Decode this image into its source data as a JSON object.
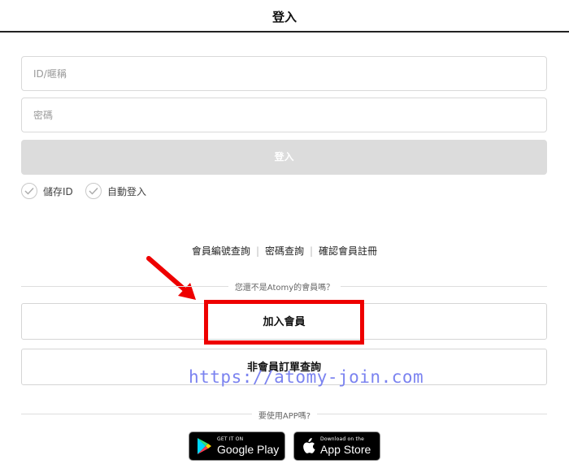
{
  "header": {
    "title": "登入"
  },
  "form": {
    "id_placeholder": "ID/暱稱",
    "password_placeholder": "密碼",
    "login_button": "登入",
    "save_id_label": "儲存ID",
    "auto_login_label": "自動登入"
  },
  "links": {
    "member_number_lookup": "會員編號查詢",
    "password_lookup": "密碼查詢",
    "confirm_registration": "確認會員註冊"
  },
  "signup": {
    "prompt": "您還不是Atomy的會員嗎？",
    "join_button": "加入會員",
    "nonmember_order_button": "非會員訂單查詢"
  },
  "watermark": "https://atomy-join.com",
  "app": {
    "prompt": "要使用APP嗎?",
    "google_small": "GET IT ON",
    "google_big": "Google Play",
    "apple_small": "Download on the",
    "apple_big": "App Store"
  },
  "colors": {
    "highlight": "#ee0000",
    "watermark": "#7b83f0",
    "login_button_bg": "#dcdcdc"
  }
}
